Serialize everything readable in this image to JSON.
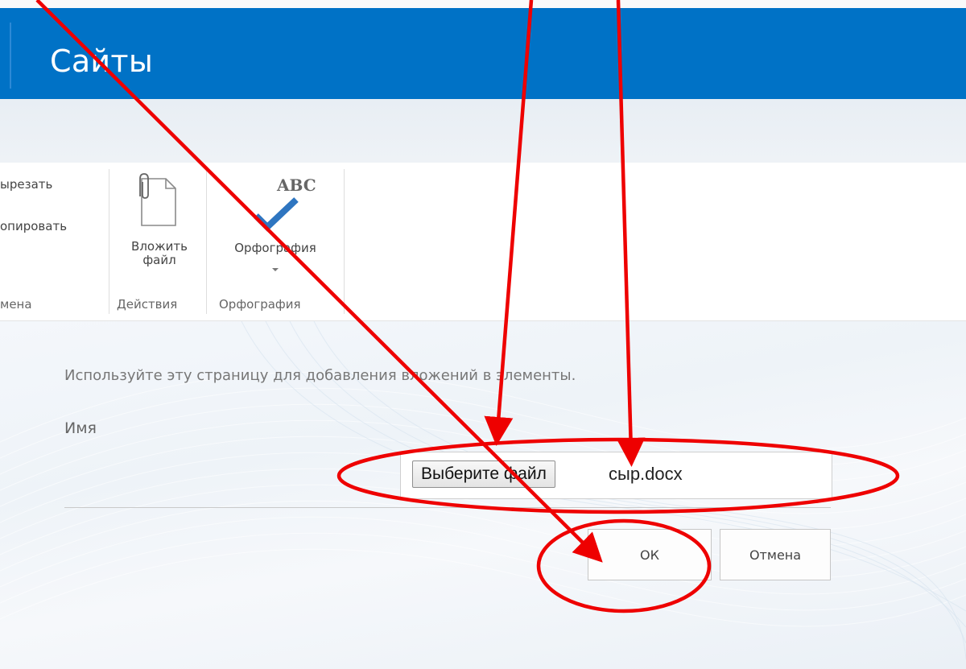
{
  "suite": {
    "title": "Сайты"
  },
  "ribbon": {
    "clipboard": {
      "cut_label": "ырезать",
      "copy_label": "опировать",
      "group_label": "мена"
    },
    "actions": {
      "attach_label_line1": "Вложить",
      "attach_label_line2": "файл",
      "group_label": "Действия",
      "attach_icon": "paperclip-document-icon"
    },
    "spelling": {
      "icon_text": "ABC",
      "button_label": "Орфография",
      "group_label": "Орфография",
      "spell_icon": "checkmark-icon"
    }
  },
  "content": {
    "intro": "Используйте эту страницу для добавления вложений в элементы.",
    "name_label": "Имя",
    "choose_file_label": "Выберите файл",
    "file_name": "сыр.docx",
    "ok_label": "ОК",
    "cancel_label": "Отмена"
  },
  "colors": {
    "suite_bar": "#0072c6",
    "annotation": "#ee0000",
    "checkmark": "#2e75c0"
  }
}
